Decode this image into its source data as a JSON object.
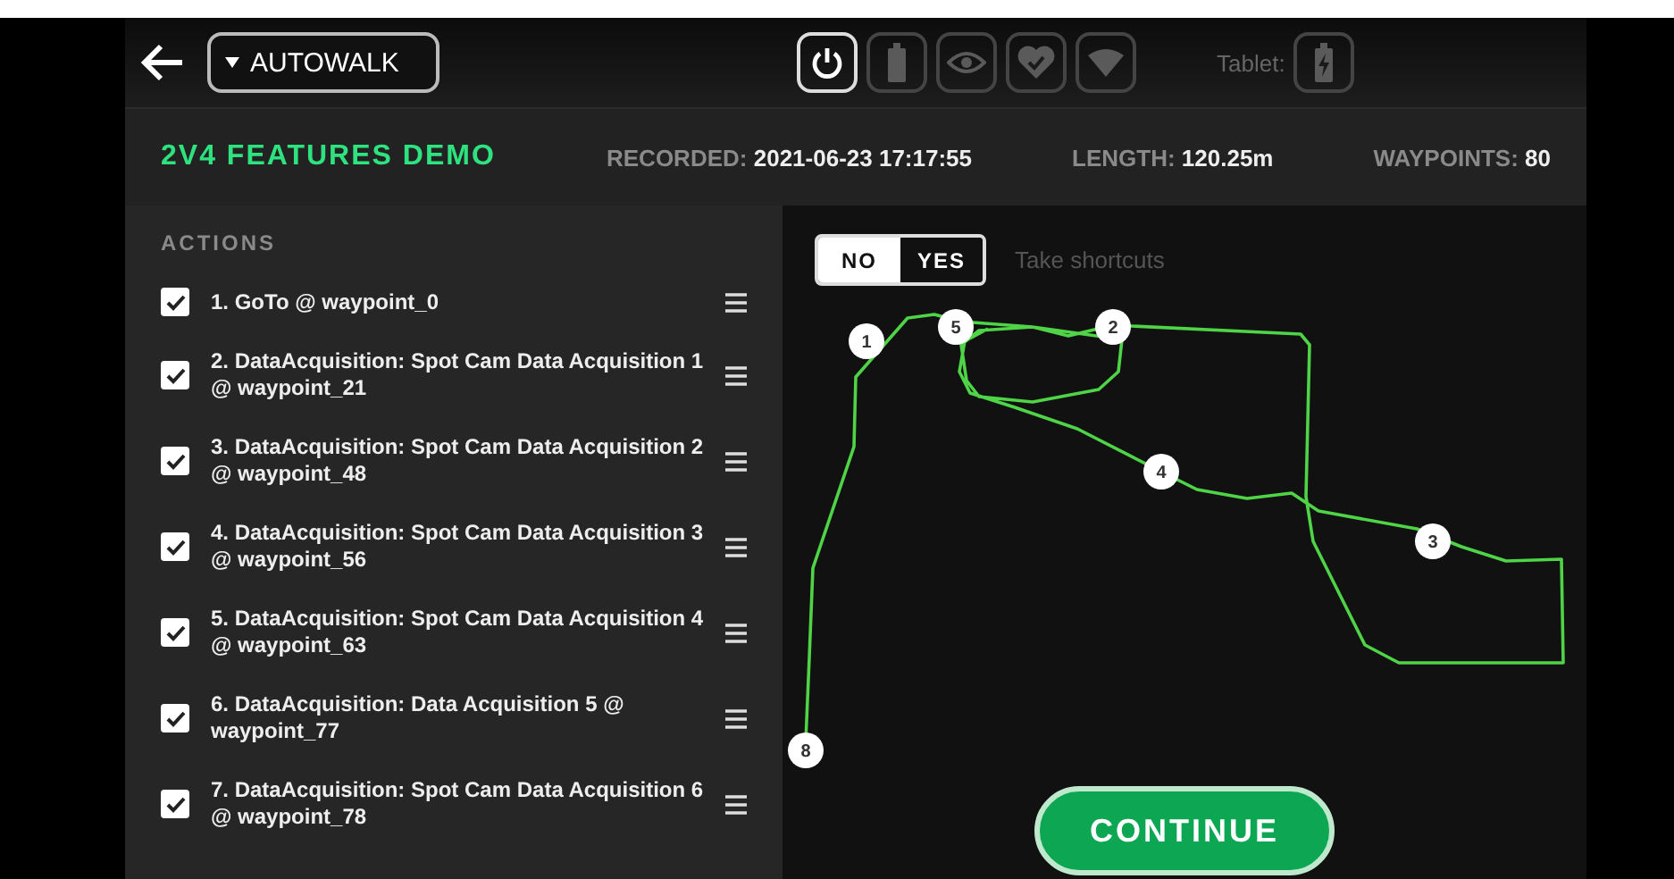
{
  "header": {
    "mode_select": {
      "value": "AUTOWALK"
    },
    "status_icons": [
      {
        "kind": "power",
        "active": true
      },
      {
        "kind": "battery",
        "active": false
      },
      {
        "kind": "eye",
        "active": false
      },
      {
        "kind": "health",
        "active": false
      },
      {
        "kind": "wifi",
        "active": false
      }
    ],
    "tablet": {
      "label": "Tablet:"
    }
  },
  "mission": {
    "title": "2V4 FEATURES DEMO",
    "stats": [
      {
        "label": "RECORDED:",
        "value": "2021-06-23 17:17:55"
      },
      {
        "label": "LENGTH:",
        "value": "120.25m"
      },
      {
        "label": "WAYPOINTS:",
        "value": "80"
      }
    ]
  },
  "actions": {
    "heading": "ACTIONS",
    "items": [
      {
        "text": "1. GoTo @ waypoint_0",
        "checked": true
      },
      {
        "text": "2. DataAcquisition: Spot Cam Data Acquisition 1 @ waypoint_21",
        "checked": true
      },
      {
        "text": "3. DataAcquisition: Spot Cam Data Acquisition 2 @ waypoint_48",
        "checked": true
      },
      {
        "text": "4. DataAcquisition: Spot Cam Data Acquisition 3 @ waypoint_56",
        "checked": true
      },
      {
        "text": "5. DataAcquisition: Spot Cam Data Acquisition 4 @ waypoint_63",
        "checked": true
      },
      {
        "text": "6. DataAcquisition: Data Acquisition 5 @ waypoint_77",
        "checked": true
      },
      {
        "text": "7. DataAcquisition: Spot Cam Data Acquisition 6 @ waypoint_78",
        "checked": true
      }
    ]
  },
  "map": {
    "shortcut_toggle": {
      "options": [
        {
          "label": "NO",
          "selected": true
        },
        {
          "label": "YES",
          "selected": false
        }
      ],
      "caption": "Take shortcuts"
    },
    "markers": [
      {
        "label": "1"
      },
      {
        "label": "5"
      },
      {
        "label": "2"
      },
      {
        "label": "4"
      },
      {
        "label": "3"
      },
      {
        "label": "8"
      }
    ],
    "continue_button": "CONTINUE"
  }
}
